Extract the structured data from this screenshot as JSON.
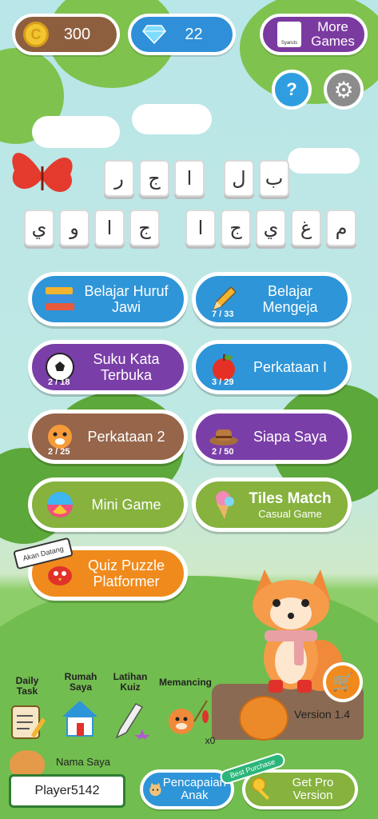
{
  "topbar": {
    "coins": "300",
    "gems": "22",
    "more_games": "More Games",
    "more_games_logo": "Syaruts"
  },
  "icons": {
    "help": "?",
    "settings": "⚙"
  },
  "tiles": {
    "row1": [
      "ب",
      "ل",
      "ا",
      "ج",
      "ر"
    ],
    "row2_left": [
      "م",
      "غ",
      "ي",
      "ج",
      "ا"
    ],
    "row2_right": [
      "ج",
      "ا",
      "و",
      "ي"
    ]
  },
  "menu": {
    "belajar_huruf": "Belajar Huruf Jawi",
    "belajar_mengeja": "Belajar Mengeja",
    "belajar_mengeja_prog": "7 / 33",
    "suku_kata": "Suku Kata Terbuka",
    "suku_kata_prog": "2 / 18",
    "perkataan1": "Perkataan I",
    "perkataan1_prog": "3 / 29",
    "perkataan2": "Perkataan 2",
    "perkataan2_prog": "2 / 25",
    "siapa_saya": "Siapa Saya",
    "siapa_saya_prog": "2 / 50",
    "mini_game": "Mini Game",
    "tiles_match": "Tiles Match",
    "tiles_match_sub": "Casual Game",
    "quiz_puzzle": "Quiz Puzzle Platformer",
    "akan_datang": "Akan Datang"
  },
  "bottom": {
    "daily_task": "Daily Task",
    "rumah_saya": "Rumah Saya",
    "latihan_kuiz": "Latihan Kuiz",
    "memancing": "Memancing",
    "memancing_count": "x0",
    "version": "Version 1.4",
    "nama_saya": "Nama Saya",
    "player_name": "Player5142",
    "pencapaian": "Pencapaian Anak",
    "best_purchase": "Best Purchase",
    "get_pro": "Get Pro Version"
  }
}
